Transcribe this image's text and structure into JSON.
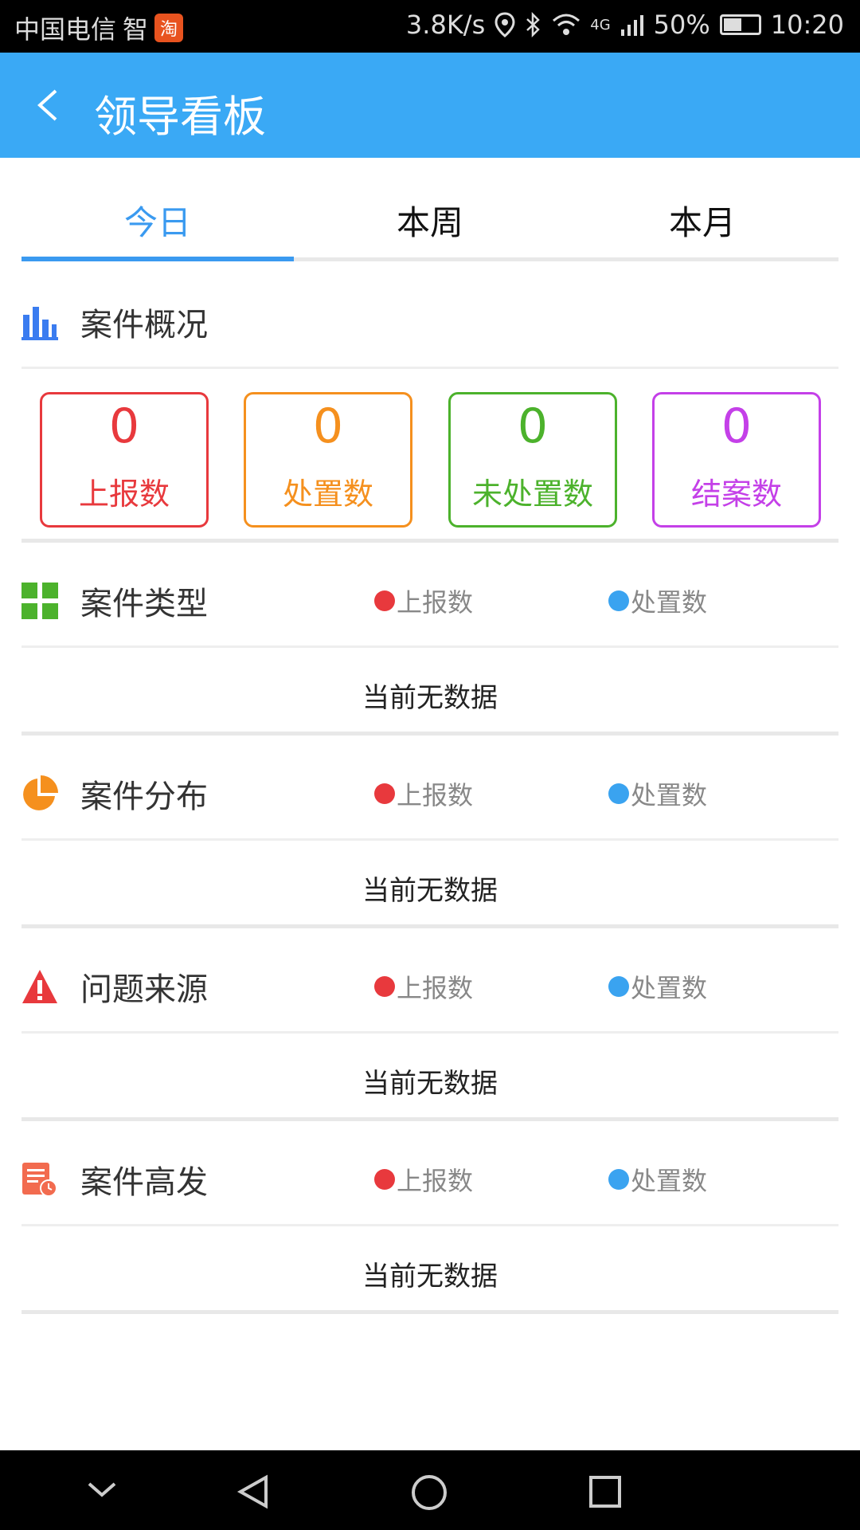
{
  "status": {
    "carrier": "中国电信",
    "carrier_extra": "智",
    "taobao": "淘",
    "speed": "3.8K/s",
    "network": "4G",
    "battery": "50%",
    "time": "10:20"
  },
  "appbar": {
    "title": "领导看板"
  },
  "tabs": [
    {
      "label": "今日"
    },
    {
      "label": "本周"
    },
    {
      "label": "本月"
    }
  ],
  "overview": {
    "title": "案件概况",
    "cards": [
      {
        "value": "0",
        "label": "上报数",
        "color": "#e8393d"
      },
      {
        "value": "0",
        "label": "处置数",
        "color": "#f5901e"
      },
      {
        "value": "0",
        "label": "未处置数",
        "color": "#4cb22c"
      },
      {
        "value": "0",
        "label": "结案数",
        "color": "#c440e8"
      }
    ]
  },
  "legend": {
    "reported": "上报数",
    "handled": "处置数",
    "reported_color": "#e8393d",
    "handled_color": "#3aa3f0"
  },
  "sections": [
    {
      "title": "案件类型",
      "empty": "当前无数据",
      "icon": "grid-icon"
    },
    {
      "title": "案件分布",
      "empty": "当前无数据",
      "icon": "pie-icon"
    },
    {
      "title": "问题来源",
      "empty": "当前无数据",
      "icon": "warning-icon"
    },
    {
      "title": "案件高发",
      "empty": "当前无数据",
      "icon": "calendar-clock-icon"
    }
  ]
}
